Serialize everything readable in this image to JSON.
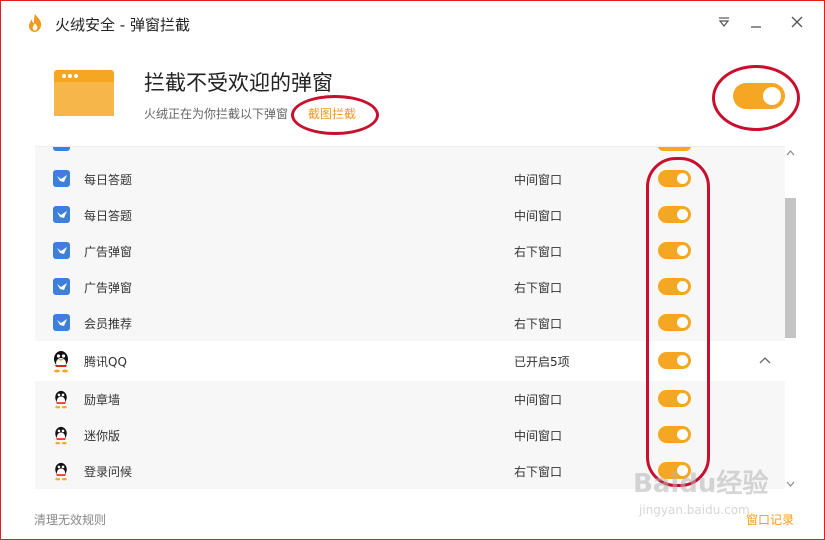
{
  "window": {
    "title": "火绒安全 - 弹窗拦截"
  },
  "header": {
    "heading": "拦截不受欢迎的弹窗",
    "subtext": "火绒正在为你拦截以下弹窗",
    "link": "截图拦截",
    "master_toggle_on": true
  },
  "rows": [
    {
      "name": "每日答题",
      "position": "中间窗口",
      "icon": "bird-app-icon",
      "on": true
    },
    {
      "name": "每日答题",
      "position": "中间窗口",
      "icon": "bird-app-icon",
      "on": true
    },
    {
      "name": "广告弹窗",
      "position": "右下窗口",
      "icon": "bird-app-icon",
      "on": true
    },
    {
      "name": "广告弹窗",
      "position": "右下窗口",
      "icon": "bird-app-icon",
      "on": true
    },
    {
      "name": "会员推荐",
      "position": "右下窗口",
      "icon": "bird-app-icon",
      "on": true
    },
    {
      "name": "腾讯QQ",
      "position": "已开启5项",
      "icon": "qq-penguin-icon",
      "on": true,
      "expanded": true
    },
    {
      "name": "励章墙",
      "position": "中间窗口",
      "icon": "qq-penguin-icon",
      "on": true
    },
    {
      "name": "迷你版",
      "position": "中间窗口",
      "icon": "qq-penguin-icon",
      "on": true
    },
    {
      "name": "登录问候",
      "position": "右下窗口",
      "icon": "qq-penguin-icon",
      "on": true
    }
  ],
  "footer": {
    "clean_rules": "清理无效规则",
    "window_log": "窗口记录"
  },
  "watermark": {
    "brand": "Baidu经验",
    "url": "jingyan.baidu.com"
  },
  "colors": {
    "accent": "#f5a623",
    "annotation": "#c8102e",
    "app_blue": "#3d7fd9"
  }
}
